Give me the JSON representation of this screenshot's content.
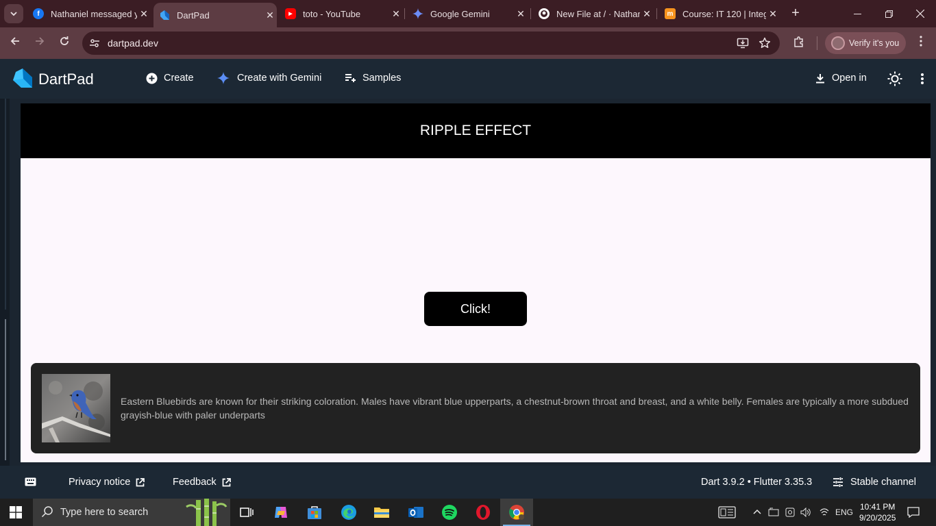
{
  "browser": {
    "tabs": [
      {
        "title": "Nathaniel messaged y",
        "favicon": "facebook-icon",
        "color": "#1877f2"
      },
      {
        "title": "DartPad",
        "favicon": "dart-icon",
        "color": "#42a5f5",
        "active": true
      },
      {
        "title": "toto - YouTube",
        "favicon": "youtube-icon",
        "color": "#ff0000"
      },
      {
        "title": "Google Gemini",
        "favicon": "gemini-icon",
        "color": "#4e86f7"
      },
      {
        "title": "New File at / · Nathan",
        "favicon": "github-icon",
        "color": "#ffffff"
      },
      {
        "title": "Course: IT 120 | Integ",
        "favicon": "moodle-icon",
        "color": "#f7931e"
      }
    ],
    "url": "dartpad.dev",
    "profile_label": "Verify it's you"
  },
  "dartpad": {
    "title": "DartPad",
    "create_label": "Create",
    "gemini_label": "Create with Gemini",
    "samples_label": "Samples",
    "open_in_label": "Open in"
  },
  "app": {
    "header_title": "RIPPLE EFFECT",
    "button_label": "Click!",
    "card_text": " Eastern Bluebirds are known for their striking coloration. Males have vibrant blue upperparts, a chestnut-brown throat and breast, and a white belly. Females are typically a more subdued grayish-blue with paler underparts"
  },
  "status": {
    "privacy_label": "Privacy notice",
    "feedback_label": "Feedback",
    "version_label": "Dart 3.9.2 • Flutter 3.35.3",
    "channel_label": "Stable channel"
  },
  "taskbar": {
    "search_placeholder": "Type here to search",
    "language": "ENG",
    "time": "10:41 PM",
    "date": "9/20/2025"
  }
}
